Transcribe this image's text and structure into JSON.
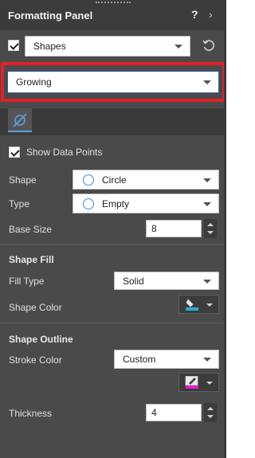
{
  "panel": {
    "title": "Formatting Panel",
    "help": "?",
    "collapse": "›"
  },
  "shapes_row": {
    "checked": true,
    "value": "Shapes",
    "reset_icon": "reset-icon"
  },
  "style_select": {
    "value": "Growing"
  },
  "tab_icon": "scatter-shape-icon",
  "show_data_points": {
    "label": "Show Data Points",
    "checked": true
  },
  "fields": {
    "shape": {
      "label": "Shape",
      "value": "Circle"
    },
    "type": {
      "label": "Type",
      "value": "Empty"
    },
    "base_size": {
      "label": "Base Size",
      "value": "8"
    }
  },
  "shape_fill": {
    "heading": "Shape Fill",
    "fill_type": {
      "label": "Fill Type",
      "value": "Solid"
    },
    "shape_color": {
      "label": "Shape Color",
      "color": "#2aa9e0"
    }
  },
  "shape_outline": {
    "heading": "Shape Outline",
    "stroke_color": {
      "label": "Stroke Color",
      "value": "Custom",
      "color": "#e020d0"
    },
    "thickness": {
      "label": "Thickness",
      "value": "4"
    }
  },
  "colors": {
    "panel_bg": "#4a4a4a",
    "header_bg": "#3c3c3c",
    "highlight": "#e3202a",
    "accent": "#5aa0e0"
  }
}
